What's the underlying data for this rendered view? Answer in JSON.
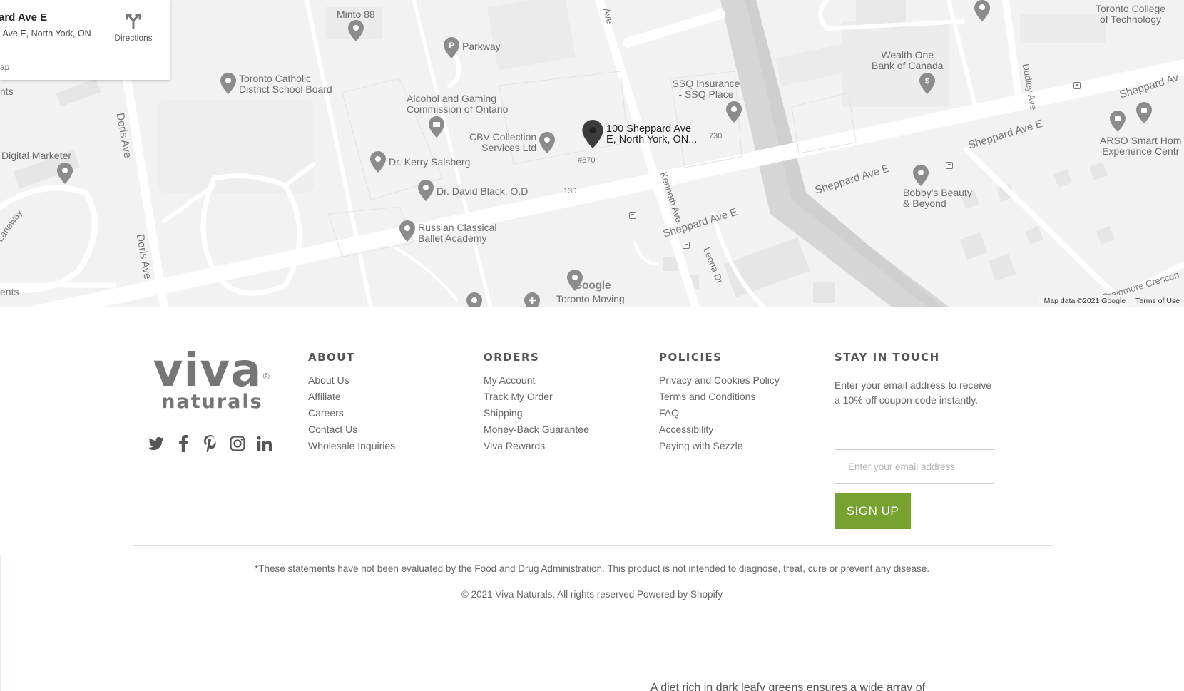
{
  "map": {
    "info_card": {
      "title": "ard Ave E",
      "address": "l Ave E, North York, ON",
      "link": "ap",
      "directions_label": "Directions"
    },
    "pois": [
      {
        "name": "Minto 88"
      },
      {
        "name": "Parkway"
      },
      {
        "name": "Toronto Catholic\nDistrict School Board"
      },
      {
        "name": "Alcohol and Gaming\nCommission of Ontario"
      },
      {
        "name": "CBV Collection\nServices Ltd"
      },
      {
        "name": "Dr. Kerry Salsberg"
      },
      {
        "name": "Dr. David Black, O.D"
      },
      {
        "name": "Russian Classical\nBallet Academy"
      },
      {
        "name": "Digital Marketer"
      },
      {
        "name": "SSQ Insurance\n- SSQ Place"
      },
      {
        "name": "Wealth One\nBank of Canada"
      },
      {
        "name": "Toronto College\nof Technology"
      },
      {
        "name": "ARSO Smart Hom\nExperience Centr"
      },
      {
        "name": "Bobby's Beauty\n& Beyond"
      },
      {
        "name": "Toronto Moving"
      },
      {
        "name": "100 Sheppard Ave\nE, North York, ON..."
      }
    ],
    "streets": {
      "doris_1": "Doris Ave",
      "doris_2": "Doris Ave",
      "sheppard_1": "Sheppard Ave E",
      "sheppard_2": "Sheppard Ave E",
      "sheppard_3": "Sheppard Ave E",
      "sheppard_4": "Sheppard Av",
      "kenneth": "Kenneth Ave",
      "leona": "Leona Dr",
      "dudley": "Dudley Ave",
      "craigmore": "Craigmore Crescen",
      "laneway": "Laneway",
      "ave_top": "Ave",
      "ents_top": "nts",
      "ents_bottom": "ents"
    },
    "small_labels": {
      "n870": "#870",
      "n130": "130",
      "n730": "730"
    },
    "google_logo": "Google",
    "map_data": "Map data ©2021 Google",
    "terms": "Terms of Use"
  },
  "footer": {
    "logo": {
      "main": "viva",
      "sub": "naturals",
      "reg": "®"
    },
    "social": [
      {
        "icon": "twitter-icon"
      },
      {
        "icon": "facebook-icon"
      },
      {
        "icon": "pinterest-icon"
      },
      {
        "icon": "instagram-icon"
      },
      {
        "icon": "linkedin-icon"
      }
    ],
    "about": {
      "heading": "ABOUT",
      "links": [
        "About Us",
        "Affiliate",
        "Careers",
        "Contact Us",
        "Wholesale Inquiries"
      ]
    },
    "orders": {
      "heading": "ORDERS",
      "links": [
        "My Account",
        "Track My Order",
        "Shipping",
        "Money-Back Guarantee",
        "Viva Rewards"
      ]
    },
    "policies": {
      "heading": "POLICIES",
      "links": [
        "Privacy and Cookies Policy",
        "Terms and Conditions",
        "FAQ",
        "Accessibility",
        "Paying with Sezzle"
      ]
    },
    "stay": {
      "heading": "STAY IN TOUCH",
      "text": "Enter your email address to receive a 10% off coupon code instantly.",
      "placeholder": "Enter your email address",
      "button": "SIGN UP"
    },
    "disclaimer": "*These statements have not been evaluated by the Food and Drug Administration. This product is not intended to diagnose, treat, cure or prevent any disease.",
    "copyright": "© 2021 Viva Naturals. All rights reserved",
    "powered_by": "Powered by Shopify",
    "cut_text": "A diet rich in dark leafy greens ensures a wide array of"
  },
  "colors": {
    "accent": "#78a22f",
    "map_bg": "#f2f2f2",
    "text": "#666666"
  }
}
